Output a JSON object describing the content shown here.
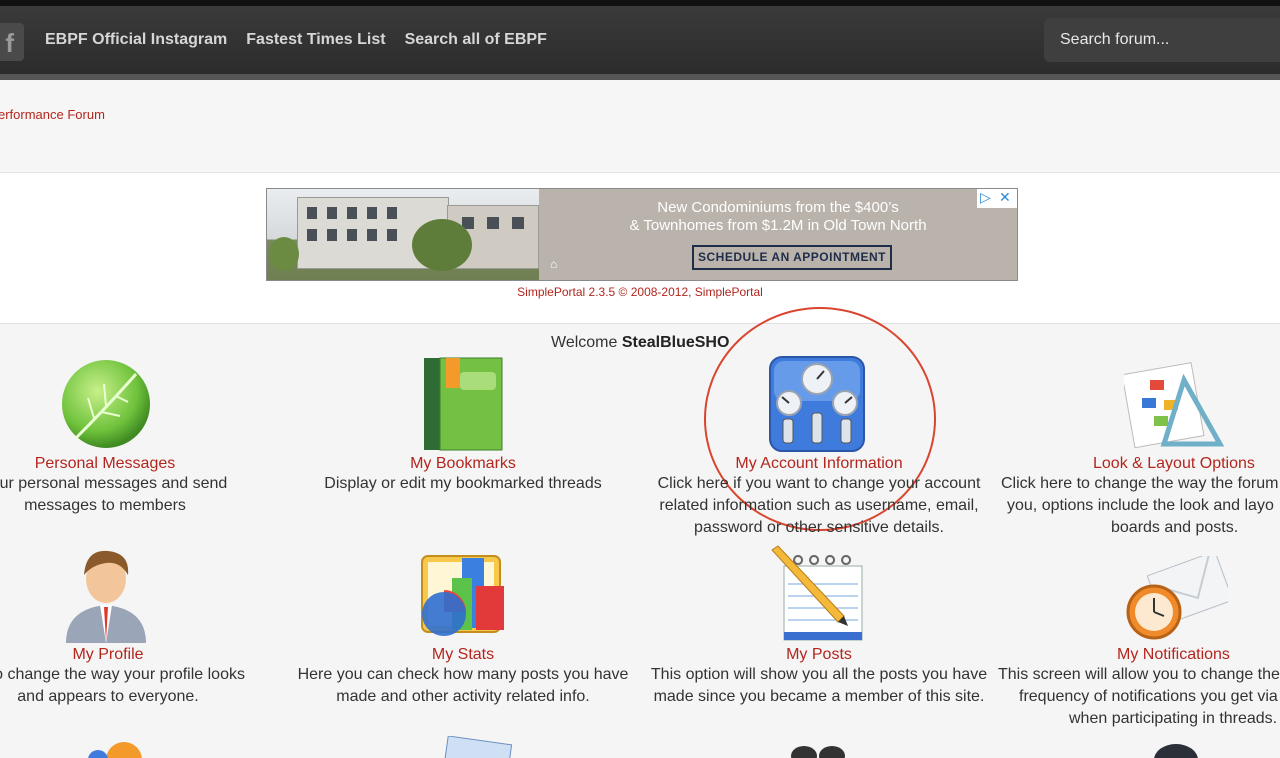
{
  "nav": {
    "fb_glyph": "f",
    "links": [
      "EBPF Official Instagram",
      "Fastest Times List",
      "Search all of EBPF"
    ],
    "search_placeholder": "Search forum..."
  },
  "breadcrumb": "erformance Forum",
  "ad": {
    "line1": "New Condominiums from the $400’s",
    "line2": "& Townhomes from $1.2M in Old Town North",
    "button": "SCHEDULE AN APPOINTMENT",
    "housing_glyph": "⌂",
    "play_glyph": "▷",
    "close_glyph": "✕"
  },
  "credit": "SimplePortal 2.3.5 © 2008-2012, SimplePortal",
  "welcome": {
    "prefix": "Welcome ",
    "username": "StealBlueSHO"
  },
  "items": [
    {
      "title": "Personal Messages",
      "desc": [
        " your personal messages and send",
        "messages to members"
      ]
    },
    {
      "title": "My Bookmarks",
      "desc": [
        "Display or edit my bookmarked threads"
      ]
    },
    {
      "title": "My Account Information",
      "desc": [
        "Click here if you want to change your account",
        "related information such as username, email,",
        "password or other sensitive details."
      ]
    },
    {
      "title": "Look & Layout Options",
      "desc": [
        "Click here to change the way the forum",
        "you, options include the look and layo",
        "boards and posts."
      ]
    },
    {
      "title": "My Profile",
      "desc": [
        "re to change the way your profile looks",
        "and appears to everyone."
      ]
    },
    {
      "title": "My Stats",
      "desc": [
        "Here you can check how many posts you have",
        "made and other activity related info."
      ]
    },
    {
      "title": "My Posts",
      "desc": [
        "This option will show you all the posts you have",
        "made since you became a member of this site."
      ]
    },
    {
      "title": "My Notifications",
      "desc": [
        "This screen will allow you to change the",
        "frequency of notifications you get via",
        "when participating in threads."
      ]
    }
  ],
  "colors": {
    "link_red": "#b3261e",
    "nav_bg": "#333333",
    "annotation": "#d9452f"
  }
}
